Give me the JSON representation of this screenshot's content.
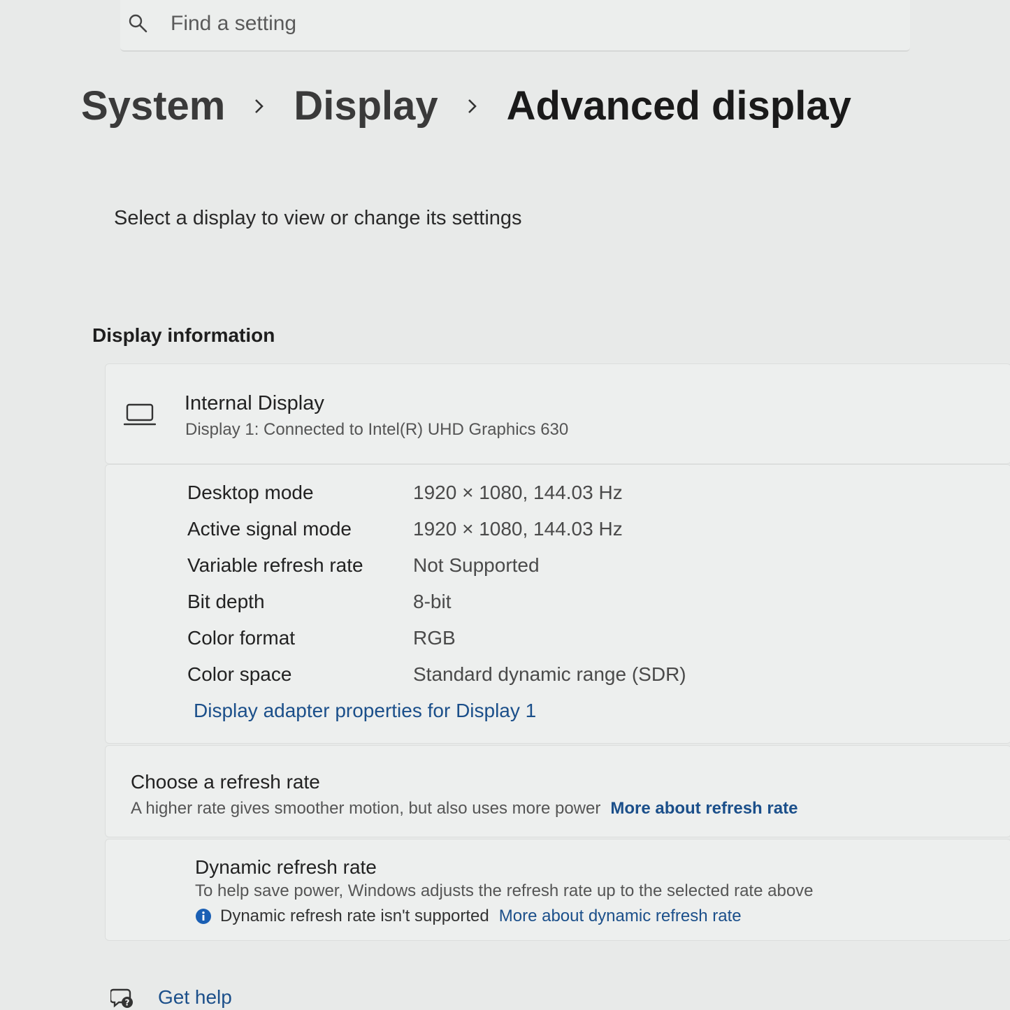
{
  "search": {
    "placeholder": "Find a setting"
  },
  "breadcrumb": {
    "items": [
      "System",
      "Display",
      "Advanced display"
    ]
  },
  "select_hint": "Select a display to view or change its settings",
  "display_information": {
    "section_title": "Display information",
    "display_name": "Internal Display",
    "display_subtitle": "Display 1: Connected to Intel(R) UHD Graphics 630",
    "rows": [
      {
        "label": "Desktop mode",
        "value": "1920 × 1080, 144.03 Hz"
      },
      {
        "label": "Active signal mode",
        "value": "1920 × 1080, 144.03 Hz"
      },
      {
        "label": "Variable refresh rate",
        "value": "Not Supported"
      },
      {
        "label": "Bit depth",
        "value": "8-bit"
      },
      {
        "label": "Color format",
        "value": "RGB"
      },
      {
        "label": "Color space",
        "value": "Standard dynamic range (SDR)"
      }
    ],
    "adapter_link": "Display adapter properties for Display 1"
  },
  "refresh_rate": {
    "title": "Choose a refresh rate",
    "description": "A higher rate gives smoother motion, but also uses more power",
    "link": "More about refresh rate"
  },
  "dynamic_refresh": {
    "title": "Dynamic refresh rate",
    "description": "To help save power, Windows adjusts the refresh rate up to the selected rate above",
    "note": "Dynamic refresh rate isn't supported",
    "link": "More about dynamic refresh rate"
  },
  "get_help": "Get help",
  "colors": {
    "link": "#1b4f8a",
    "info_icon": "#1a5fb4"
  }
}
